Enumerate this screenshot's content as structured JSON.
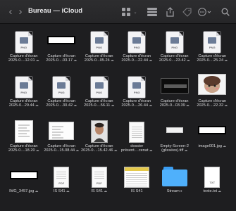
{
  "window": {
    "title": "Bureau — iCloud",
    "back_glyph": "‹",
    "forward_glyph": "›"
  },
  "toolbar": {
    "icons": [
      "view-grid-icon",
      "group-icon",
      "share-icon",
      "tag-icon",
      "more-icon",
      "search-icon"
    ]
  },
  "colors": {
    "window_bg": "#1e1e20",
    "folder_blue": "#4fb0fb",
    "label_text": "#d9d9db"
  },
  "files": [
    {
      "line1": "Capture d'écran",
      "line2": "2025-0....12.01",
      "cloud": "☁",
      "kind": "png"
    },
    {
      "line1": "Capture d'écran",
      "line2": "2025-0....03.17",
      "cloud": "☁",
      "kind": "shot-wide"
    },
    {
      "line1": "Capture d'écran",
      "line2": "2025-0...05.24",
      "cloud": "☁",
      "kind": "png"
    },
    {
      "line1": "Capture d'écran",
      "line2": "2025-0....22.44",
      "cloud": "☁",
      "kind": "png"
    },
    {
      "line1": "Capture d'écran",
      "line2": "2025-0....23.42",
      "cloud": "☁",
      "kind": "png"
    },
    {
      "line1": "Capture d'écran",
      "line2": "2025-0....25.24",
      "cloud": "☁",
      "kind": "png"
    },
    {
      "line1": "Capture d'écran",
      "line2": "2025-0...29.44",
      "cloud": "☁",
      "kind": "png"
    },
    {
      "line1": "Capture d'écran",
      "line2": "2025-0....30.42",
      "cloud": "☁",
      "kind": "png"
    },
    {
      "line1": "Capture d'écran",
      "line2": "2025-0....56.11",
      "cloud": "☁",
      "kind": "png"
    },
    {
      "line1": "Capture d'écran",
      "line2": "2025-0....26.44",
      "cloud": "☁",
      "kind": "png"
    },
    {
      "line1": "Capture d'écran",
      "line2": "2025-0...03.39",
      "cloud": "☁",
      "kind": "shot-dark"
    },
    {
      "line1": "Capture d'écran",
      "line2": "2025-0....22.32",
      "cloud": "☁",
      "kind": "shot-photo"
    },
    {
      "line1": "Capture d'écran",
      "line2": "2025-0....18.20",
      "cloud": "☁",
      "kind": "shot-doc"
    },
    {
      "line1": "Capture d'écran",
      "line2": "2025-0...15.08.44",
      "cloud": "☁",
      "kind": "shot-doc2"
    },
    {
      "line1": "Capture d'écran",
      "line2": "2025-0....15.42.46",
      "cloud": "☁",
      "kind": "face"
    },
    {
      "line1": "dossier",
      "line2": "présent....cenat",
      "cloud": "☁",
      "kind": "txtdoc"
    },
    {
      "line1": "Empty-Screen-2",
      "line2": "(glissées).tiff",
      "cloud": "☁",
      "kind": "shot-slim"
    },
    {
      "line1": "image001.jpg",
      "line2": "",
      "cloud": "☁",
      "kind": "shot-wide"
    },
    {
      "line1": "IMG_3457.jpg",
      "line2": "",
      "cloud": "☁",
      "kind": "shot-wide"
    },
    {
      "line1": "IS S41",
      "line2": "",
      "cloud": "☁",
      "kind": "pdf"
    },
    {
      "line1": "IS S41",
      "line2": "",
      "cloud": "☁",
      "kind": "pdf"
    },
    {
      "line1": "IS S41",
      "line2": "",
      "cloud": "",
      "kind": "sheet"
    },
    {
      "line1": "Stream",
      "line2": "",
      "cloud": "●",
      "kind": "folder"
    },
    {
      "line1": "texte.txt",
      "line2": "",
      "cloud": "☁",
      "kind": "txt"
    }
  ]
}
